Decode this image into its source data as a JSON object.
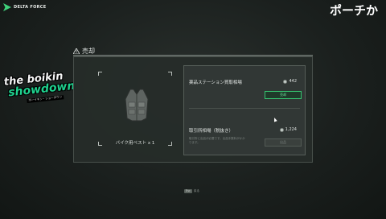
{
  "brand": {
    "name": "DELTA FORCE",
    "sub": "",
    "accent": "#3fd07a"
  },
  "overlay": {
    "title": "ポーチか"
  },
  "sticker": {
    "line1": "the boikin",
    "line2": "showdown",
    "line3": "ボーイキン・ショーダウン"
  },
  "dialog": {
    "title": "売却",
    "item_name": "バイク用ベスト x 1",
    "row1": {
      "label": "薬品ステーション買取相場",
      "value": "442",
      "button": "売却"
    },
    "row2": {
      "label": "取引所相場（税抜き）",
      "value": "1,224",
      "note": "取引所に出品が必要です。出品手数料がかかります。",
      "button": "出品"
    }
  },
  "footer": {
    "key": "Esc",
    "label": "戻る"
  },
  "colors": {
    "accent_green": "#35c36f",
    "panel": "#262c29"
  },
  "icons": {
    "warning": "warning-icon",
    "currency": "coin-icon"
  }
}
